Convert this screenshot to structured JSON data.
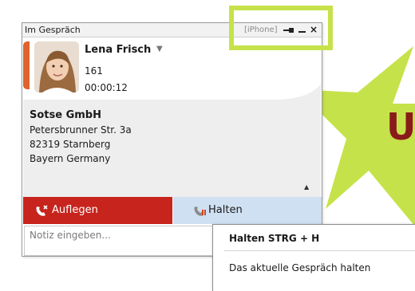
{
  "window": {
    "title": "Im Gespräch",
    "device_label": "[iPhone]",
    "close_symbol": "×",
    "pin_icon": "pin-icon",
    "minimize_icon": "minimize-icon",
    "close_icon": "close-icon"
  },
  "contact": {
    "name": "Lena Frisch",
    "dropdown_symbol": "▼",
    "extension": "161",
    "timer": "00:00:12",
    "accent_color": "#e0622d"
  },
  "company": {
    "name": "Sotse GmbH",
    "street": "Petersbrunner Str. 3a",
    "city": "82319 Starnberg",
    "region": "Bayern Germany",
    "scroll_symbol": "▲"
  },
  "actions": {
    "hangup_label": "Auflegen",
    "hangup_color": "#c6241c",
    "hold_label": "Halten",
    "hold_color": "#cfe0f2"
  },
  "note": {
    "placeholder": "Notiz eingeben..."
  },
  "tooltip": {
    "title": "Halten STRG + H",
    "description": "Das aktuelle Gespräch halten"
  },
  "background": {
    "star_color": "#c6e24a",
    "partial_text": "U",
    "text_color": "#8a1b1b"
  }
}
